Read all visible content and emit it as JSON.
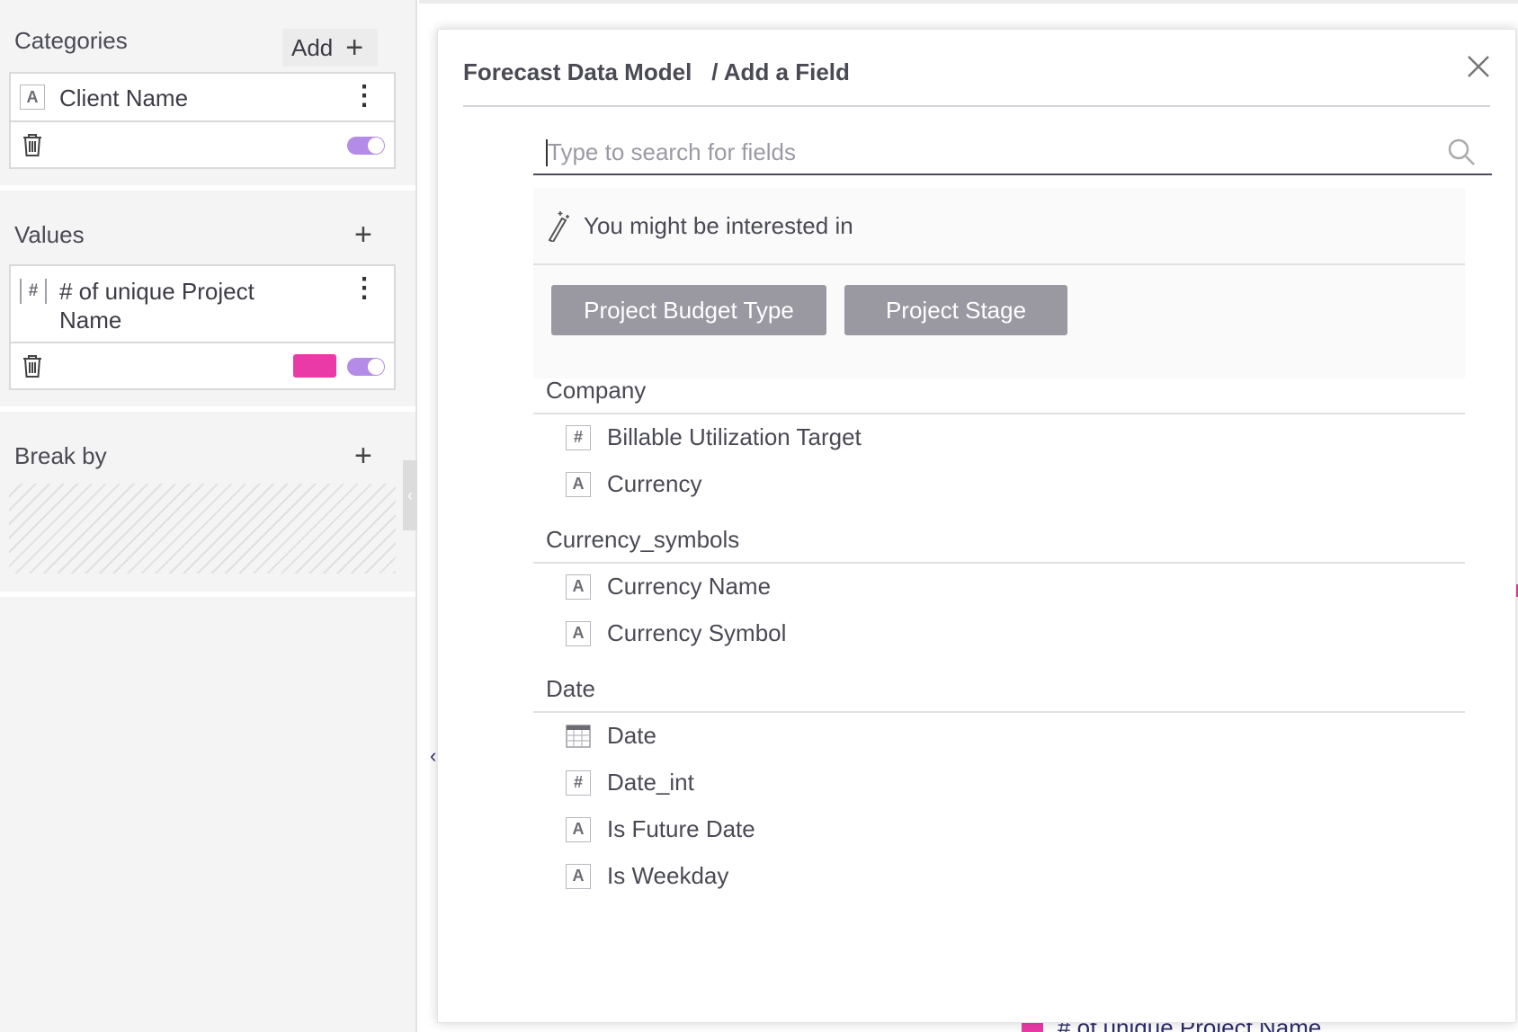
{
  "sidebar": {
    "categories": {
      "title": "Categories",
      "add_label": "Add",
      "item": {
        "type": "A",
        "label": "Client Name"
      }
    },
    "values": {
      "title": "Values",
      "item": {
        "type": "#",
        "label": "# of unique Project Name",
        "swatch_color": "#ea3aa7"
      }
    },
    "break_by": {
      "title": "Break by"
    }
  },
  "background": {
    "legend_label": "# of unique Project Name",
    "legend_color": "#ea3aa7"
  },
  "modal": {
    "breadcrumb_model": "Forecast Data Model",
    "breadcrumb_page": "/ Add a Field",
    "search": {
      "placeholder": "Type to search for fields",
      "value": ""
    },
    "suggestions": {
      "heading": "You might be interested in",
      "chips": [
        "Project Budget Type",
        "Project Stage"
      ]
    },
    "groups": [
      {
        "title": "Company",
        "fields": [
          {
            "type": "#",
            "icon": "number-icon",
            "label": "Billable Utilization Target"
          },
          {
            "type": "A",
            "icon": "text-icon",
            "label": "Currency"
          }
        ]
      },
      {
        "title": "Currency_symbols",
        "fields": [
          {
            "type": "A",
            "icon": "text-icon",
            "label": "Currency Name"
          },
          {
            "type": "A",
            "icon": "text-icon",
            "label": "Currency Symbol"
          }
        ]
      },
      {
        "title": "Date",
        "fields": [
          {
            "type": "cal",
            "icon": "calendar-icon",
            "label": "Date"
          },
          {
            "type": "#",
            "icon": "number-icon",
            "label": "Date_int"
          },
          {
            "type": "A",
            "icon": "text-icon",
            "label": "Is Future Date"
          },
          {
            "type": "A",
            "icon": "text-icon",
            "label": "Is Weekday"
          }
        ]
      }
    ]
  },
  "colors": {
    "accent_toggle": "#b48be6",
    "chip_bg": "#9a99a2"
  }
}
